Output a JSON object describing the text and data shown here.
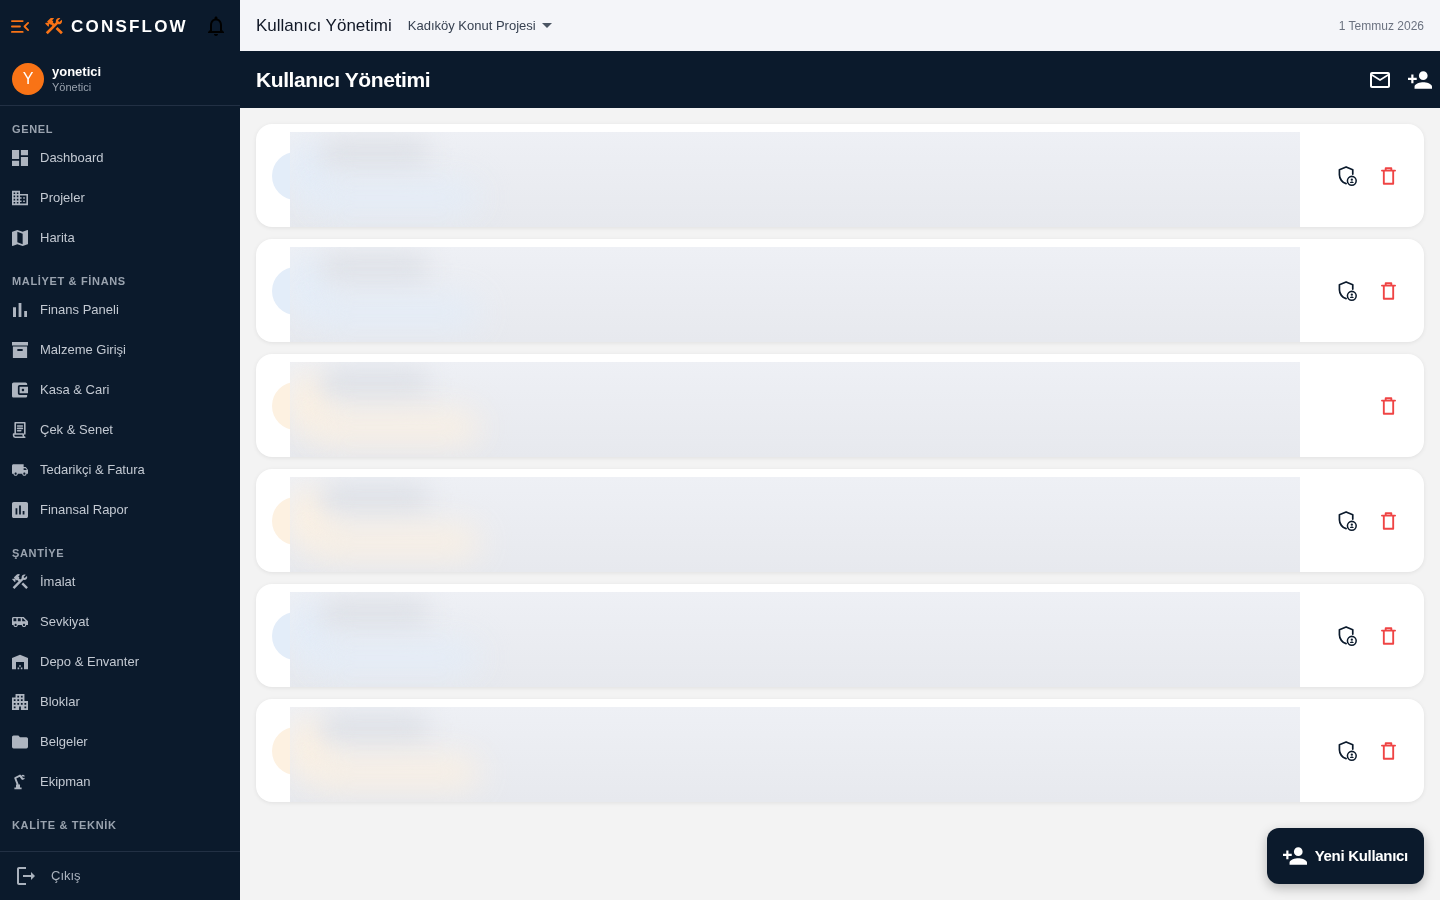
{
  "sidebar": {
    "brand": "CONSFLOW",
    "user": {
      "initial": "Y",
      "name": "yonetici",
      "role": "Yönetici"
    },
    "sections": [
      {
        "title": "GENEL",
        "items": [
          {
            "label": "Dashboard"
          },
          {
            "label": "Projeler"
          },
          {
            "label": "Harita"
          }
        ]
      },
      {
        "title": "MALİYET & FİNANS",
        "items": [
          {
            "label": "Finans Paneli"
          },
          {
            "label": "Malzeme Girişi"
          },
          {
            "label": "Kasa & Cari"
          },
          {
            "label": "Çek & Senet"
          },
          {
            "label": "Tedarikçi & Fatura"
          },
          {
            "label": "Finansal Rapor"
          }
        ]
      },
      {
        "title": "ŞANTİYE",
        "items": [
          {
            "label": "İmalat"
          },
          {
            "label": "Sevkiyat"
          },
          {
            "label": "Depo & Envanter"
          },
          {
            "label": "Bloklar"
          },
          {
            "label": "Belgeler"
          },
          {
            "label": "Ekipman"
          }
        ]
      },
      {
        "title": "KALİTE & TEKNİK"
      }
    ],
    "logout": "Çıkış"
  },
  "topbar": {
    "title": "Kullanıcı Yönetimi",
    "project": "Kadıköy Konut Projesi",
    "date": "1 Temmuz 2026"
  },
  "page_header": {
    "title": "Kullanıcı Yönetimi"
  },
  "users": [
    {
      "color": "#e3edf9",
      "role_action": true
    },
    {
      "color": "#e3edf9",
      "role_action": true
    },
    {
      "color": "#fdf1e1",
      "role_action": false
    },
    {
      "color": "#fdf1e1",
      "role_action": true
    },
    {
      "color": "#e3edf9",
      "role_action": true
    },
    {
      "color": "#fdf1e1",
      "role_action": true
    }
  ],
  "new_user_button": {
    "label": "Yeni Kullanıcı"
  }
}
